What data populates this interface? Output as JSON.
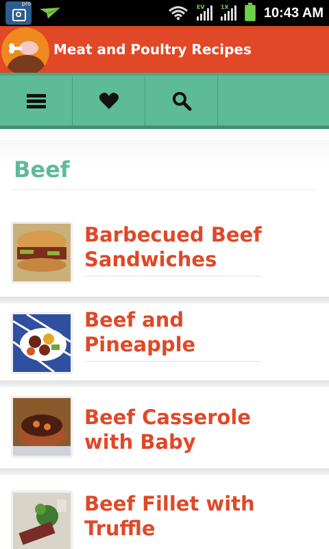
{
  "status_bar": {
    "time": "10:43 AM",
    "camera_badge": "pro",
    "signal_1_label": "EV",
    "signal_2_label": "1X"
  },
  "app_bar": {
    "title": "Meat and Poultry Recipes"
  },
  "toolbar": {
    "buttons": [
      {
        "name": "menu",
        "icon": "menu-icon"
      },
      {
        "name": "favorites",
        "icon": "heart-icon"
      },
      {
        "name": "search",
        "icon": "search-icon"
      }
    ]
  },
  "section": {
    "title": "Beef"
  },
  "recipes": [
    {
      "title": "Barbecued Beef Sandwiches"
    },
    {
      "title": "Beef and Pineapple"
    },
    {
      "title": "Beef Casserole with Baby"
    },
    {
      "title": "Beef Fillet with Truffle"
    }
  ],
  "colors": {
    "header": "#e04827",
    "toolbar": "#5dbb97",
    "section_title": "#5dbb97",
    "item_title": "#e04827"
  }
}
